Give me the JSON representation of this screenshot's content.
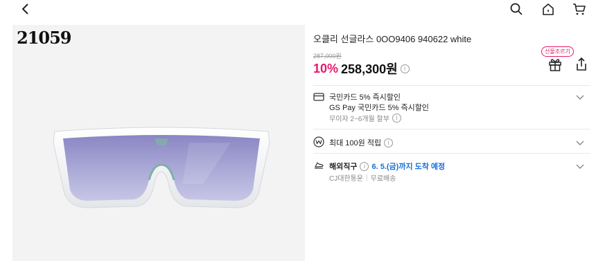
{
  "header": {
    "back_icon": "chevron-left-icon",
    "search_icon": "search-icon",
    "home_icon": "home-icon",
    "cart_icon": "cart-icon"
  },
  "image": {
    "number_label": "21059"
  },
  "product": {
    "title": "오클리 선글라스 0OO9406 940622 white",
    "original_price": "287,000원",
    "discount": "10%",
    "price": "258,300원",
    "gift_badge": "선물조르기",
    "info_glyph": "i"
  },
  "card_benefit": {
    "line1": "국민카드 5% 즉시할인",
    "line2": "GS Pay 국민카드 5% 즉시할인",
    "installment": "무이자 2~6개월 할부"
  },
  "points": {
    "label": "최대 100원 적립"
  },
  "shipping": {
    "label": "해외직구",
    "arrival": "6. 5.(금)까지 도착 예정",
    "carrier": "CJ대한통운",
    "separator": "|",
    "fee": "무료배송"
  },
  "colors": {
    "accent": "#e6196d",
    "link_blue": "#1a6fd8",
    "image_bg": "#f3f3f3"
  }
}
